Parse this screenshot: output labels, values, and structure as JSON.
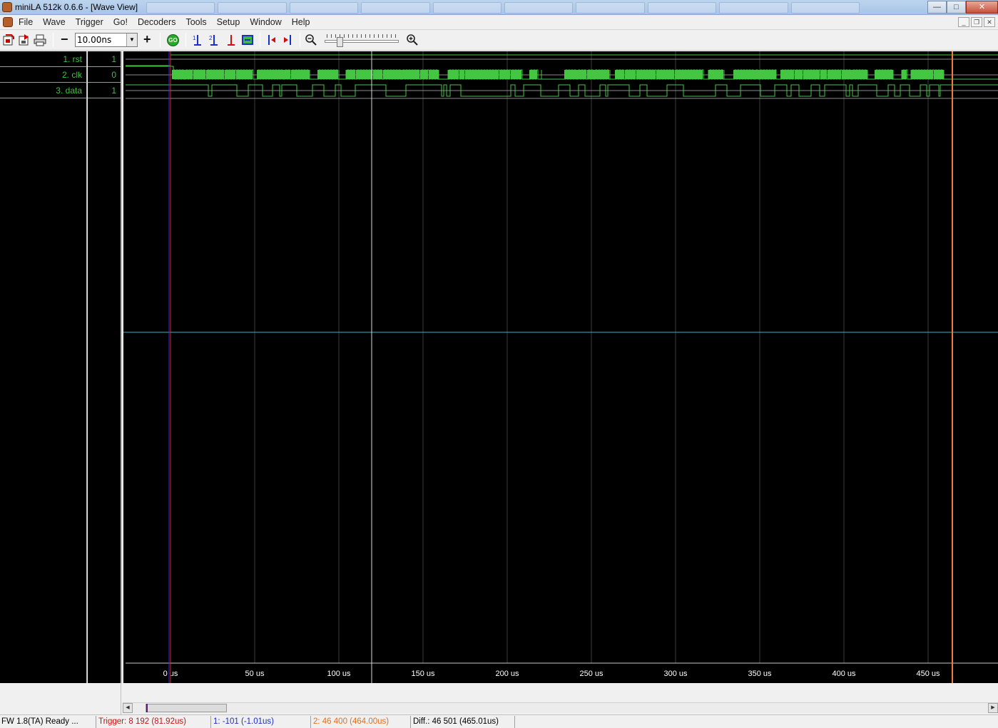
{
  "window": {
    "title": "miniLA 512k 0.6.6 - [Wave View]",
    "controls": {
      "minimize": "—",
      "maximize": "□",
      "close": "✕"
    }
  },
  "menu": [
    "File",
    "Wave",
    "Trigger",
    "Go!",
    "Decoders",
    "Tools",
    "Setup",
    "Window",
    "Help"
  ],
  "mdi_controls": {
    "minimize": "_",
    "restore": "❐",
    "close": "✕"
  },
  "toolbar": {
    "zoom_minus": "−",
    "zoom_value": "10.00ns",
    "zoom_plus": "+",
    "go_label": "GO",
    "zoom_slider_level": 0.18
  },
  "channels": [
    {
      "label": "1. rst",
      "value": "1"
    },
    {
      "label": "2. clk",
      "value": "0"
    },
    {
      "label": "3. data",
      "value": "1"
    }
  ],
  "time_axis": {
    "unit_labels": [
      "0 us",
      "50 us",
      "100 us",
      "150 us",
      "200 us",
      "250 us",
      "300 us",
      "350 us",
      "400 us",
      "450 us"
    ]
  },
  "colors": {
    "signal": "#43c743",
    "trigger_cursor": "#e02020",
    "cursor1": "#3030d0",
    "cursor2": "#f07b3a",
    "threshold": "#2fb8c8"
  },
  "status": {
    "firmware": "FW 1.8(TA) Ready ...",
    "trigger": "Trigger: 8 192  (81.92us)",
    "cursor1": "1: -101  (-1.01us)",
    "cursor2": "2: 46 400  (464.00us)",
    "diff": "Diff.: 46 501  (465.01us)",
    "trigger_color": "#d01010",
    "cursor1_color": "#1a2fc8",
    "cursor2_color": "#e07020"
  }
}
